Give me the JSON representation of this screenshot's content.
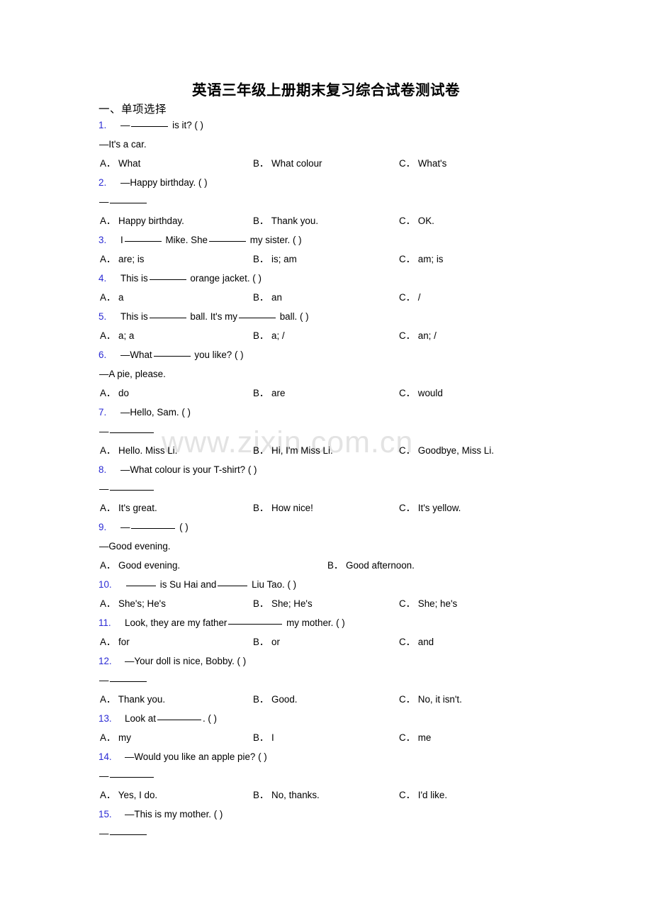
{
  "document": {
    "title": "英语三年级上册期末复习综合试卷测试卷",
    "section_heading": "一、单项选择",
    "watermark": "www.zixin.com.cn",
    "number_color": "#2a2ad4"
  },
  "questions": [
    {
      "number": "1.",
      "stem_prefix": "—",
      "stem_suffix": " is it? (   )",
      "blank": "medium",
      "continuation": "—It's a car.",
      "options": [
        {
          "label": "A．",
          "text": "What"
        },
        {
          "label": "B．",
          "text": "What colour"
        },
        {
          "label": "C．",
          "text": "What's"
        }
      ]
    },
    {
      "number": "2.",
      "stem_prefix": "—Happy birthday. (   )",
      "stem_suffix": "",
      "blank": "none",
      "continuation": "—",
      "continuation_blank": "medium",
      "options": [
        {
          "label": "A．",
          "text": "Happy birthday."
        },
        {
          "label": "B．",
          "text": "Thank you."
        },
        {
          "label": "C．",
          "text": "OK."
        }
      ]
    },
    {
      "number": "3.",
      "stem_prefix": "I",
      "stem_mid": " Mike. She",
      "stem_suffix": " my sister. (   )",
      "blank": "medium",
      "options": [
        {
          "label": "A．",
          "text": "are; is"
        },
        {
          "label": "B．",
          "text": "is; am"
        },
        {
          "label": "C．",
          "text": "am; is"
        }
      ]
    },
    {
      "number": "4.",
      "stem_prefix": "This is",
      "stem_suffix": " orange jacket. (   )",
      "blank": "medium",
      "options": [
        {
          "label": "A．",
          "text": "a"
        },
        {
          "label": "B．",
          "text": "an"
        },
        {
          "label": "C．",
          "text": "/"
        }
      ]
    },
    {
      "number": "5.",
      "stem_prefix": "This is",
      "stem_mid": " ball. It's my",
      "stem_suffix": " ball. (   )",
      "blank": "medium",
      "options": [
        {
          "label": "A．",
          "text": "a; a"
        },
        {
          "label": "B．",
          "text": "a; /"
        },
        {
          "label": "C．",
          "text": "an; /"
        }
      ]
    },
    {
      "number": "6.",
      "stem_prefix": "—What",
      "stem_suffix": " you like? (   )",
      "blank": "medium",
      "continuation": "—A pie, please.",
      "options": [
        {
          "label": "A．",
          "text": "do"
        },
        {
          "label": "B．",
          "text": "are"
        },
        {
          "label": "C．",
          "text": "would"
        }
      ]
    },
    {
      "number": "7.",
      "stem_prefix": "—Hello, Sam. (   )",
      "stem_suffix": "",
      "blank": "none",
      "continuation": "—",
      "continuation_blank": "large",
      "options": [
        {
          "label": "A．",
          "text": "Hello. Miss Li."
        },
        {
          "label": "B．",
          "text": "Hi, I'm Miss Li."
        },
        {
          "label": "C．",
          "text": "Goodbye, Miss Li."
        }
      ]
    },
    {
      "number": "8.",
      "stem_prefix": "—What colour is your T-shirt? (   )",
      "stem_suffix": "",
      "blank": "none",
      "continuation": "—",
      "continuation_blank": "large",
      "options": [
        {
          "label": "A．",
          "text": "It's great."
        },
        {
          "label": "B．",
          "text": "How nice!"
        },
        {
          "label": "C．",
          "text": "It's yellow."
        }
      ]
    },
    {
      "number": "9.",
      "stem_prefix": "—",
      "stem_suffix": " (  )",
      "blank": "large",
      "continuation": "—Good evening.",
      "options": [
        {
          "label": "A．",
          "text": "Good evening."
        },
        {
          "label": "B．",
          "text": "Good afternoon."
        }
      ],
      "two_column_wide": true
    },
    {
      "number": "10.",
      "stem_prefix": "",
      "stem_mid": " is Su Hai and",
      "stem_suffix": " Liu Tao. (  )",
      "blank": "small",
      "options": [
        {
          "label": "A．",
          "text": "She's; He's"
        },
        {
          "label": "B．",
          "text": "She; He's"
        },
        {
          "label": "C．",
          "text": "She; he's"
        }
      ]
    },
    {
      "number": "11.",
      "stem_prefix": "Look, they are my father",
      "stem_suffix": " my mother. (  )",
      "blank": "xlarge",
      "options": [
        {
          "label": "A．",
          "text": "for"
        },
        {
          "label": "B．",
          "text": "or"
        },
        {
          "label": "C．",
          "text": "and"
        }
      ]
    },
    {
      "number": "12.",
      "stem_prefix": "—Your doll is nice, Bobby. (   )",
      "stem_suffix": "",
      "blank": "none",
      "continuation": "—",
      "continuation_blank": "medium",
      "options": [
        {
          "label": "A．",
          "text": "Thank you."
        },
        {
          "label": "B．",
          "text": "Good."
        },
        {
          "label": "C．",
          "text": "No, it isn't."
        }
      ]
    },
    {
      "number": "13.",
      "stem_prefix": "Look at",
      "stem_suffix": ". (  )",
      "blank": "large",
      "options": [
        {
          "label": "A．",
          "text": "my"
        },
        {
          "label": "B．",
          "text": "I"
        },
        {
          "label": "C．",
          "text": "me"
        }
      ]
    },
    {
      "number": "14.",
      "stem_prefix": "—Would you like an apple pie? (   )",
      "stem_suffix": "",
      "blank": "none",
      "continuation": "—",
      "continuation_blank": "large",
      "options": [
        {
          "label": "A．",
          "text": "Yes, I do."
        },
        {
          "label": "B．",
          "text": "No, thanks."
        },
        {
          "label": "C．",
          "text": "I'd like."
        }
      ]
    },
    {
      "number": "15.",
      "stem_prefix": "—This is my mother. (   )",
      "stem_suffix": "",
      "blank": "none",
      "continuation": "—",
      "continuation_blank": "medium",
      "options": []
    }
  ]
}
